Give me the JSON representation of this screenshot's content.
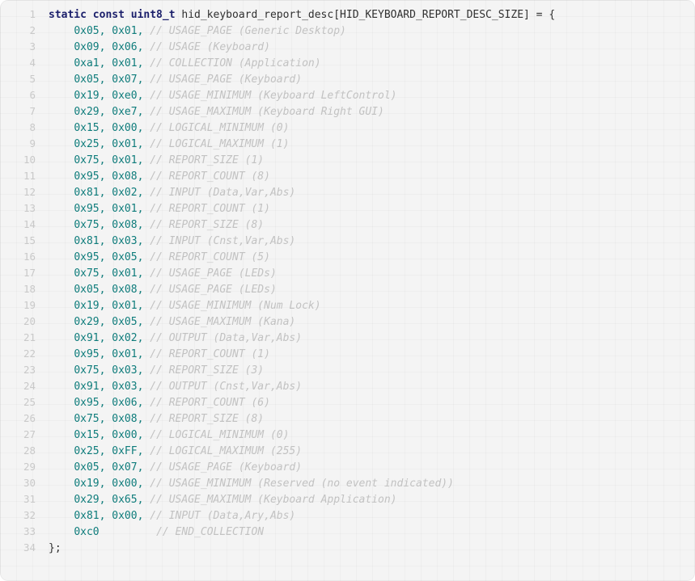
{
  "editor": {
    "language": "c",
    "background_color": "#f4f4f4",
    "grid_color": "#ededed",
    "line_number_color": "#c9c9c9",
    "keyword_color": "#1b1f6b",
    "number_color": "#0e7c7b",
    "comment_color": "#c2c2c2",
    "identifier_color": "#303030",
    "first_line_number": 1,
    "last_line_number": 34,
    "total_lines": 34
  },
  "lines": [
    {
      "number": "1",
      "indent": "",
      "tokens": [
        {
          "type": "kw",
          "text": "static const uint8_t"
        },
        {
          "type": "plain",
          "text": " "
        },
        {
          "type": "ident",
          "text": "hid_keyboard_report_desc[HID_KEYBOARD_REPORT_DESC_SIZE] = {"
        }
      ]
    },
    {
      "number": "2",
      "indent": "    ",
      "tokens": [
        {
          "type": "num",
          "text": "0x05"
        },
        {
          "type": "punct",
          "text": ", "
        },
        {
          "type": "num",
          "text": "0x01"
        },
        {
          "type": "punct",
          "text": ", "
        },
        {
          "type": "comment",
          "text": "// USAGE_PAGE (Generic Desktop)"
        }
      ]
    },
    {
      "number": "3",
      "indent": "    ",
      "tokens": [
        {
          "type": "num",
          "text": "0x09"
        },
        {
          "type": "punct",
          "text": ", "
        },
        {
          "type": "num",
          "text": "0x06"
        },
        {
          "type": "punct",
          "text": ", "
        },
        {
          "type": "comment",
          "text": "// USAGE (Keyboard)"
        }
      ]
    },
    {
      "number": "4",
      "indent": "    ",
      "tokens": [
        {
          "type": "num",
          "text": "0xa1"
        },
        {
          "type": "punct",
          "text": ", "
        },
        {
          "type": "num",
          "text": "0x01"
        },
        {
          "type": "punct",
          "text": ", "
        },
        {
          "type": "comment",
          "text": "// COLLECTION (Application)"
        }
      ]
    },
    {
      "number": "5",
      "indent": "    ",
      "tokens": [
        {
          "type": "num",
          "text": "0x05"
        },
        {
          "type": "punct",
          "text": ", "
        },
        {
          "type": "num",
          "text": "0x07"
        },
        {
          "type": "punct",
          "text": ", "
        },
        {
          "type": "comment",
          "text": "// USAGE_PAGE (Keyboard)"
        }
      ]
    },
    {
      "number": "6",
      "indent": "    ",
      "tokens": [
        {
          "type": "num",
          "text": "0x19"
        },
        {
          "type": "punct",
          "text": ", "
        },
        {
          "type": "num",
          "text": "0xe0"
        },
        {
          "type": "punct",
          "text": ", "
        },
        {
          "type": "comment",
          "text": "// USAGE_MINIMUM (Keyboard LeftControl)"
        }
      ]
    },
    {
      "number": "7",
      "indent": "    ",
      "tokens": [
        {
          "type": "num",
          "text": "0x29"
        },
        {
          "type": "punct",
          "text": ", "
        },
        {
          "type": "num",
          "text": "0xe7"
        },
        {
          "type": "punct",
          "text": ", "
        },
        {
          "type": "comment",
          "text": "// USAGE_MAXIMUM (Keyboard Right GUI)"
        }
      ]
    },
    {
      "number": "8",
      "indent": "    ",
      "tokens": [
        {
          "type": "num",
          "text": "0x15"
        },
        {
          "type": "punct",
          "text": ", "
        },
        {
          "type": "num",
          "text": "0x00"
        },
        {
          "type": "punct",
          "text": ", "
        },
        {
          "type": "comment",
          "text": "// LOGICAL_MINIMUM (0)"
        }
      ]
    },
    {
      "number": "9",
      "indent": "    ",
      "tokens": [
        {
          "type": "num",
          "text": "0x25"
        },
        {
          "type": "punct",
          "text": ", "
        },
        {
          "type": "num",
          "text": "0x01"
        },
        {
          "type": "punct",
          "text": ", "
        },
        {
          "type": "comment",
          "text": "// LOGICAL_MAXIMUM (1)"
        }
      ]
    },
    {
      "number": "10",
      "indent": "    ",
      "tokens": [
        {
          "type": "num",
          "text": "0x75"
        },
        {
          "type": "punct",
          "text": ", "
        },
        {
          "type": "num",
          "text": "0x01"
        },
        {
          "type": "punct",
          "text": ", "
        },
        {
          "type": "comment",
          "text": "// REPORT_SIZE (1)"
        }
      ]
    },
    {
      "number": "11",
      "indent": "    ",
      "tokens": [
        {
          "type": "num",
          "text": "0x95"
        },
        {
          "type": "punct",
          "text": ", "
        },
        {
          "type": "num",
          "text": "0x08"
        },
        {
          "type": "punct",
          "text": ", "
        },
        {
          "type": "comment",
          "text": "// REPORT_COUNT (8)"
        }
      ]
    },
    {
      "number": "12",
      "indent": "    ",
      "tokens": [
        {
          "type": "num",
          "text": "0x81"
        },
        {
          "type": "punct",
          "text": ", "
        },
        {
          "type": "num",
          "text": "0x02"
        },
        {
          "type": "punct",
          "text": ", "
        },
        {
          "type": "comment",
          "text": "// INPUT (Data,Var,Abs)"
        }
      ]
    },
    {
      "number": "13",
      "indent": "    ",
      "tokens": [
        {
          "type": "num",
          "text": "0x95"
        },
        {
          "type": "punct",
          "text": ", "
        },
        {
          "type": "num",
          "text": "0x01"
        },
        {
          "type": "punct",
          "text": ", "
        },
        {
          "type": "comment",
          "text": "// REPORT_COUNT (1)"
        }
      ]
    },
    {
      "number": "14",
      "indent": "    ",
      "tokens": [
        {
          "type": "num",
          "text": "0x75"
        },
        {
          "type": "punct",
          "text": ", "
        },
        {
          "type": "num",
          "text": "0x08"
        },
        {
          "type": "punct",
          "text": ", "
        },
        {
          "type": "comment",
          "text": "// REPORT_SIZE (8)"
        }
      ]
    },
    {
      "number": "15",
      "indent": "    ",
      "tokens": [
        {
          "type": "num",
          "text": "0x81"
        },
        {
          "type": "punct",
          "text": ", "
        },
        {
          "type": "num",
          "text": "0x03"
        },
        {
          "type": "punct",
          "text": ", "
        },
        {
          "type": "comment",
          "text": "// INPUT (Cnst,Var,Abs)"
        }
      ]
    },
    {
      "number": "16",
      "indent": "    ",
      "tokens": [
        {
          "type": "num",
          "text": "0x95"
        },
        {
          "type": "punct",
          "text": ", "
        },
        {
          "type": "num",
          "text": "0x05"
        },
        {
          "type": "punct",
          "text": ", "
        },
        {
          "type": "comment",
          "text": "// REPORT_COUNT (5)"
        }
      ]
    },
    {
      "number": "17",
      "indent": "    ",
      "tokens": [
        {
          "type": "num",
          "text": "0x75"
        },
        {
          "type": "punct",
          "text": ", "
        },
        {
          "type": "num",
          "text": "0x01"
        },
        {
          "type": "punct",
          "text": ", "
        },
        {
          "type": "comment",
          "text": "// USAGE_PAGE (LEDs)"
        }
      ]
    },
    {
      "number": "18",
      "indent": "    ",
      "tokens": [
        {
          "type": "num",
          "text": "0x05"
        },
        {
          "type": "punct",
          "text": ", "
        },
        {
          "type": "num",
          "text": "0x08"
        },
        {
          "type": "punct",
          "text": ", "
        },
        {
          "type": "comment",
          "text": "// USAGE_PAGE (LEDs)"
        }
      ]
    },
    {
      "number": "19",
      "indent": "    ",
      "tokens": [
        {
          "type": "num",
          "text": "0x19"
        },
        {
          "type": "punct",
          "text": ", "
        },
        {
          "type": "num",
          "text": "0x01"
        },
        {
          "type": "punct",
          "text": ", "
        },
        {
          "type": "comment",
          "text": "// USAGE_MINIMUM (Num Lock)"
        }
      ]
    },
    {
      "number": "20",
      "indent": "    ",
      "tokens": [
        {
          "type": "num",
          "text": "0x29"
        },
        {
          "type": "punct",
          "text": ", "
        },
        {
          "type": "num",
          "text": "0x05"
        },
        {
          "type": "punct",
          "text": ", "
        },
        {
          "type": "comment",
          "text": "// USAGE_MAXIMUM (Kana)"
        }
      ]
    },
    {
      "number": "21",
      "indent": "    ",
      "tokens": [
        {
          "type": "num",
          "text": "0x91"
        },
        {
          "type": "punct",
          "text": ", "
        },
        {
          "type": "num",
          "text": "0x02"
        },
        {
          "type": "punct",
          "text": ", "
        },
        {
          "type": "comment",
          "text": "// OUTPUT (Data,Var,Abs)"
        }
      ]
    },
    {
      "number": "22",
      "indent": "    ",
      "tokens": [
        {
          "type": "num",
          "text": "0x95"
        },
        {
          "type": "punct",
          "text": ", "
        },
        {
          "type": "num",
          "text": "0x01"
        },
        {
          "type": "punct",
          "text": ", "
        },
        {
          "type": "comment",
          "text": "// REPORT_COUNT (1)"
        }
      ]
    },
    {
      "number": "23",
      "indent": "    ",
      "tokens": [
        {
          "type": "num",
          "text": "0x75"
        },
        {
          "type": "punct",
          "text": ", "
        },
        {
          "type": "num",
          "text": "0x03"
        },
        {
          "type": "punct",
          "text": ", "
        },
        {
          "type": "comment",
          "text": "// REPORT_SIZE (3)"
        }
      ]
    },
    {
      "number": "24",
      "indent": "    ",
      "tokens": [
        {
          "type": "num",
          "text": "0x91"
        },
        {
          "type": "punct",
          "text": ", "
        },
        {
          "type": "num",
          "text": "0x03"
        },
        {
          "type": "punct",
          "text": ", "
        },
        {
          "type": "comment",
          "text": "// OUTPUT (Cnst,Var,Abs)"
        }
      ]
    },
    {
      "number": "25",
      "indent": "    ",
      "tokens": [
        {
          "type": "num",
          "text": "0x95"
        },
        {
          "type": "punct",
          "text": ", "
        },
        {
          "type": "num",
          "text": "0x06"
        },
        {
          "type": "punct",
          "text": ", "
        },
        {
          "type": "comment",
          "text": "// REPORT_COUNT (6)"
        }
      ]
    },
    {
      "number": "26",
      "indent": "    ",
      "tokens": [
        {
          "type": "num",
          "text": "0x75"
        },
        {
          "type": "punct",
          "text": ", "
        },
        {
          "type": "num",
          "text": "0x08"
        },
        {
          "type": "punct",
          "text": ", "
        },
        {
          "type": "comment",
          "text": "// REPORT_SIZE (8)"
        }
      ]
    },
    {
      "number": "27",
      "indent": "    ",
      "tokens": [
        {
          "type": "num",
          "text": "0x15"
        },
        {
          "type": "punct",
          "text": ", "
        },
        {
          "type": "num",
          "text": "0x00"
        },
        {
          "type": "punct",
          "text": ", "
        },
        {
          "type": "comment",
          "text": "// LOGICAL_MINIMUM (0)"
        }
      ]
    },
    {
      "number": "28",
      "indent": "    ",
      "tokens": [
        {
          "type": "num",
          "text": "0x25"
        },
        {
          "type": "punct",
          "text": ", "
        },
        {
          "type": "num",
          "text": "0xFF"
        },
        {
          "type": "punct",
          "text": ", "
        },
        {
          "type": "comment",
          "text": "// LOGICAL_MAXIMUM (255)"
        }
      ]
    },
    {
      "number": "29",
      "indent": "    ",
      "tokens": [
        {
          "type": "num",
          "text": "0x05"
        },
        {
          "type": "punct",
          "text": ", "
        },
        {
          "type": "num",
          "text": "0x07"
        },
        {
          "type": "punct",
          "text": ", "
        },
        {
          "type": "comment",
          "text": "// USAGE_PAGE (Keyboard)"
        }
      ]
    },
    {
      "number": "30",
      "indent": "    ",
      "tokens": [
        {
          "type": "num",
          "text": "0x19"
        },
        {
          "type": "punct",
          "text": ", "
        },
        {
          "type": "num",
          "text": "0x00"
        },
        {
          "type": "punct",
          "text": ", "
        },
        {
          "type": "comment",
          "text": "// USAGE_MINIMUM (Reserved (no event indicated))"
        }
      ]
    },
    {
      "number": "31",
      "indent": "    ",
      "tokens": [
        {
          "type": "num",
          "text": "0x29"
        },
        {
          "type": "punct",
          "text": ", "
        },
        {
          "type": "num",
          "text": "0x65"
        },
        {
          "type": "punct",
          "text": ", "
        },
        {
          "type": "comment",
          "text": "// USAGE_MAXIMUM (Keyboard Application)"
        }
      ]
    },
    {
      "number": "32",
      "indent": "    ",
      "tokens": [
        {
          "type": "num",
          "text": "0x81"
        },
        {
          "type": "punct",
          "text": ", "
        },
        {
          "type": "num",
          "text": "0x00"
        },
        {
          "type": "punct",
          "text": ", "
        },
        {
          "type": "comment",
          "text": "// INPUT (Data,Ary,Abs)"
        }
      ]
    },
    {
      "number": "33",
      "indent": "    ",
      "tokens": [
        {
          "type": "num",
          "text": "0xc0"
        },
        {
          "type": "plain",
          "text": "         "
        },
        {
          "type": "comment",
          "text": "// END_COLLECTION"
        }
      ]
    },
    {
      "number": "34",
      "indent": "",
      "tokens": [
        {
          "type": "plain",
          "text": "};"
        }
      ]
    }
  ]
}
